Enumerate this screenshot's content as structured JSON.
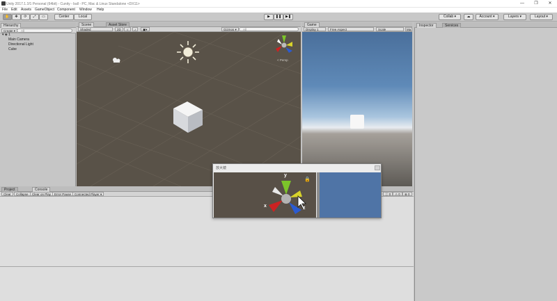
{
  "window": {
    "title": "Unity 2017.1.1f1 Personal (64bit) - Cunity - ball - PC, Mac & Linux Standalone <DX11>",
    "minimize": "—",
    "maximize": "❐",
    "close": "✕"
  },
  "menu": [
    "File",
    "Edit",
    "Assets",
    "GameObject",
    "Component",
    "Window",
    "Help"
  ],
  "toolbar": {
    "tools": [
      "✋",
      "✥",
      "⟳",
      "⤢",
      "▭"
    ],
    "center_label": "Center",
    "local_label": "Local",
    "play": "▶",
    "pause": "❚❚",
    "step": "▶❚",
    "collab_label": "Collab ▾",
    "cloud_icon": "☁",
    "account_label": "Account ▾",
    "layers_label": "Layers ▾",
    "layout_label": "Layout ▾"
  },
  "hierarchy": {
    "tab": "Hierarchy",
    "create_label": "Create ▾",
    "search_placeholder": "All",
    "scene_name": "1",
    "items": [
      "Main Camera",
      "Directional Light",
      "Cube"
    ]
  },
  "scene": {
    "tabs": [
      "Scene",
      "Asset Store"
    ],
    "shading": "Shaded",
    "mode_2d": "2D",
    "gizmos_label": "Gizmos ▾",
    "search_placeholder": "All",
    "persp_label": "< Persp"
  },
  "game": {
    "tab": "Game",
    "display": "Display 1",
    "aspect": "Free Aspect",
    "scale_label": "Scale",
    "maximize_label": "Ma"
  },
  "inspector": {
    "tabs": [
      "Inspector",
      "Services"
    ]
  },
  "console": {
    "tabs": [
      "Project",
      "Console"
    ],
    "buttons": [
      "Clear",
      "Collapse",
      "Clear on Play",
      "Error Pause",
      "Connected Player ▾"
    ],
    "counts": [
      "0",
      "0",
      "0"
    ]
  },
  "magnifier": {
    "title": "放大镜",
    "axis_y": "y",
    "axis_x": "x",
    "axis_z": "z"
  },
  "colors": {
    "scene_bg": "#595248",
    "sky_top": "#4a6f9b",
    "gizmo_x": "#cc2222",
    "gizmo_y": "#66b822",
    "gizmo_z": "#2255cc"
  }
}
